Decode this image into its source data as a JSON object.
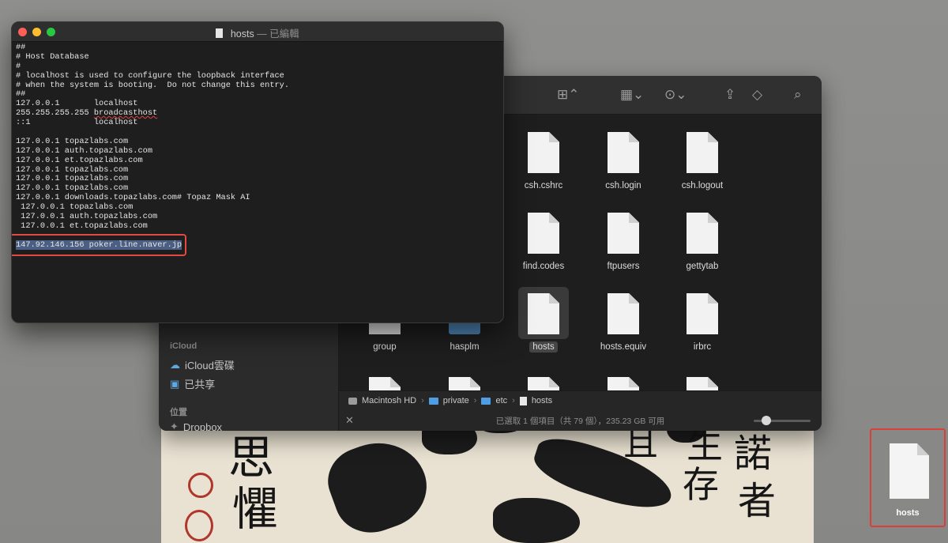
{
  "textedit": {
    "filename": "hosts",
    "edited_marker": "— 已編輯",
    "lines": [
      "##",
      "# Host Database",
      "#",
      "# localhost is used to configure the loopback interface",
      "# when the system is booting.  Do not change this entry.",
      "##",
      "127.0.0.1       localhost",
      "255.255.255.255 broadcasthost",
      "::1             localhost",
      "",
      "127.0.0.1 topazlabs.com",
      "127.0.0.1 auth.topazlabs.com",
      "127.0.0.1 et.topazlabs.com",
      "127.0.0.1 topazlabs.com",
      "127.0.0.1 topazlabs.com",
      "127.0.0.1 topazlabs.com",
      "127.0.0.1 downloads.topazlabs.com# Topaz Mask AI",
      " 127.0.0.1 topazlabs.com",
      " 127.0.0.1 auth.topazlabs.com",
      " 127.0.0.1 et.topazlabs.com",
      "",
      "147.92.146.156 poker.line.naver.jp"
    ],
    "selected_line_index": 21,
    "misspelled_word": "broadcasthost"
  },
  "finder": {
    "sidebar": {
      "icloud_header": "iCloud",
      "icloud_drive": "iCloud雲碟",
      "shared": "已共享",
      "locations_header": "位置",
      "dropbox": "Dropbox"
    },
    "files": [
      {
        "name": "csh.cshrc"
      },
      {
        "name": "csh.login"
      },
      {
        "name": "csh.logout"
      },
      {
        "name": "find.codes"
      },
      {
        "name": "ftpusers"
      },
      {
        "name": "gettytab"
      },
      {
        "name": "group"
      },
      {
        "name": "hasplm"
      },
      {
        "name": "hosts",
        "selected": true
      },
      {
        "name": "hosts.equiv"
      },
      {
        "name": "irbrc"
      }
    ],
    "path": [
      "Macintosh HD",
      "private",
      "etc",
      "hosts"
    ],
    "status": "已選取 1 個項目（共 79 個），235.23 GB 可用"
  },
  "desktop": {
    "icon_label": "hosts"
  },
  "colors": {
    "highlight_border": "#e04a40",
    "selection": "#4a5f83",
    "folder_blue": "#4f9ee3"
  }
}
